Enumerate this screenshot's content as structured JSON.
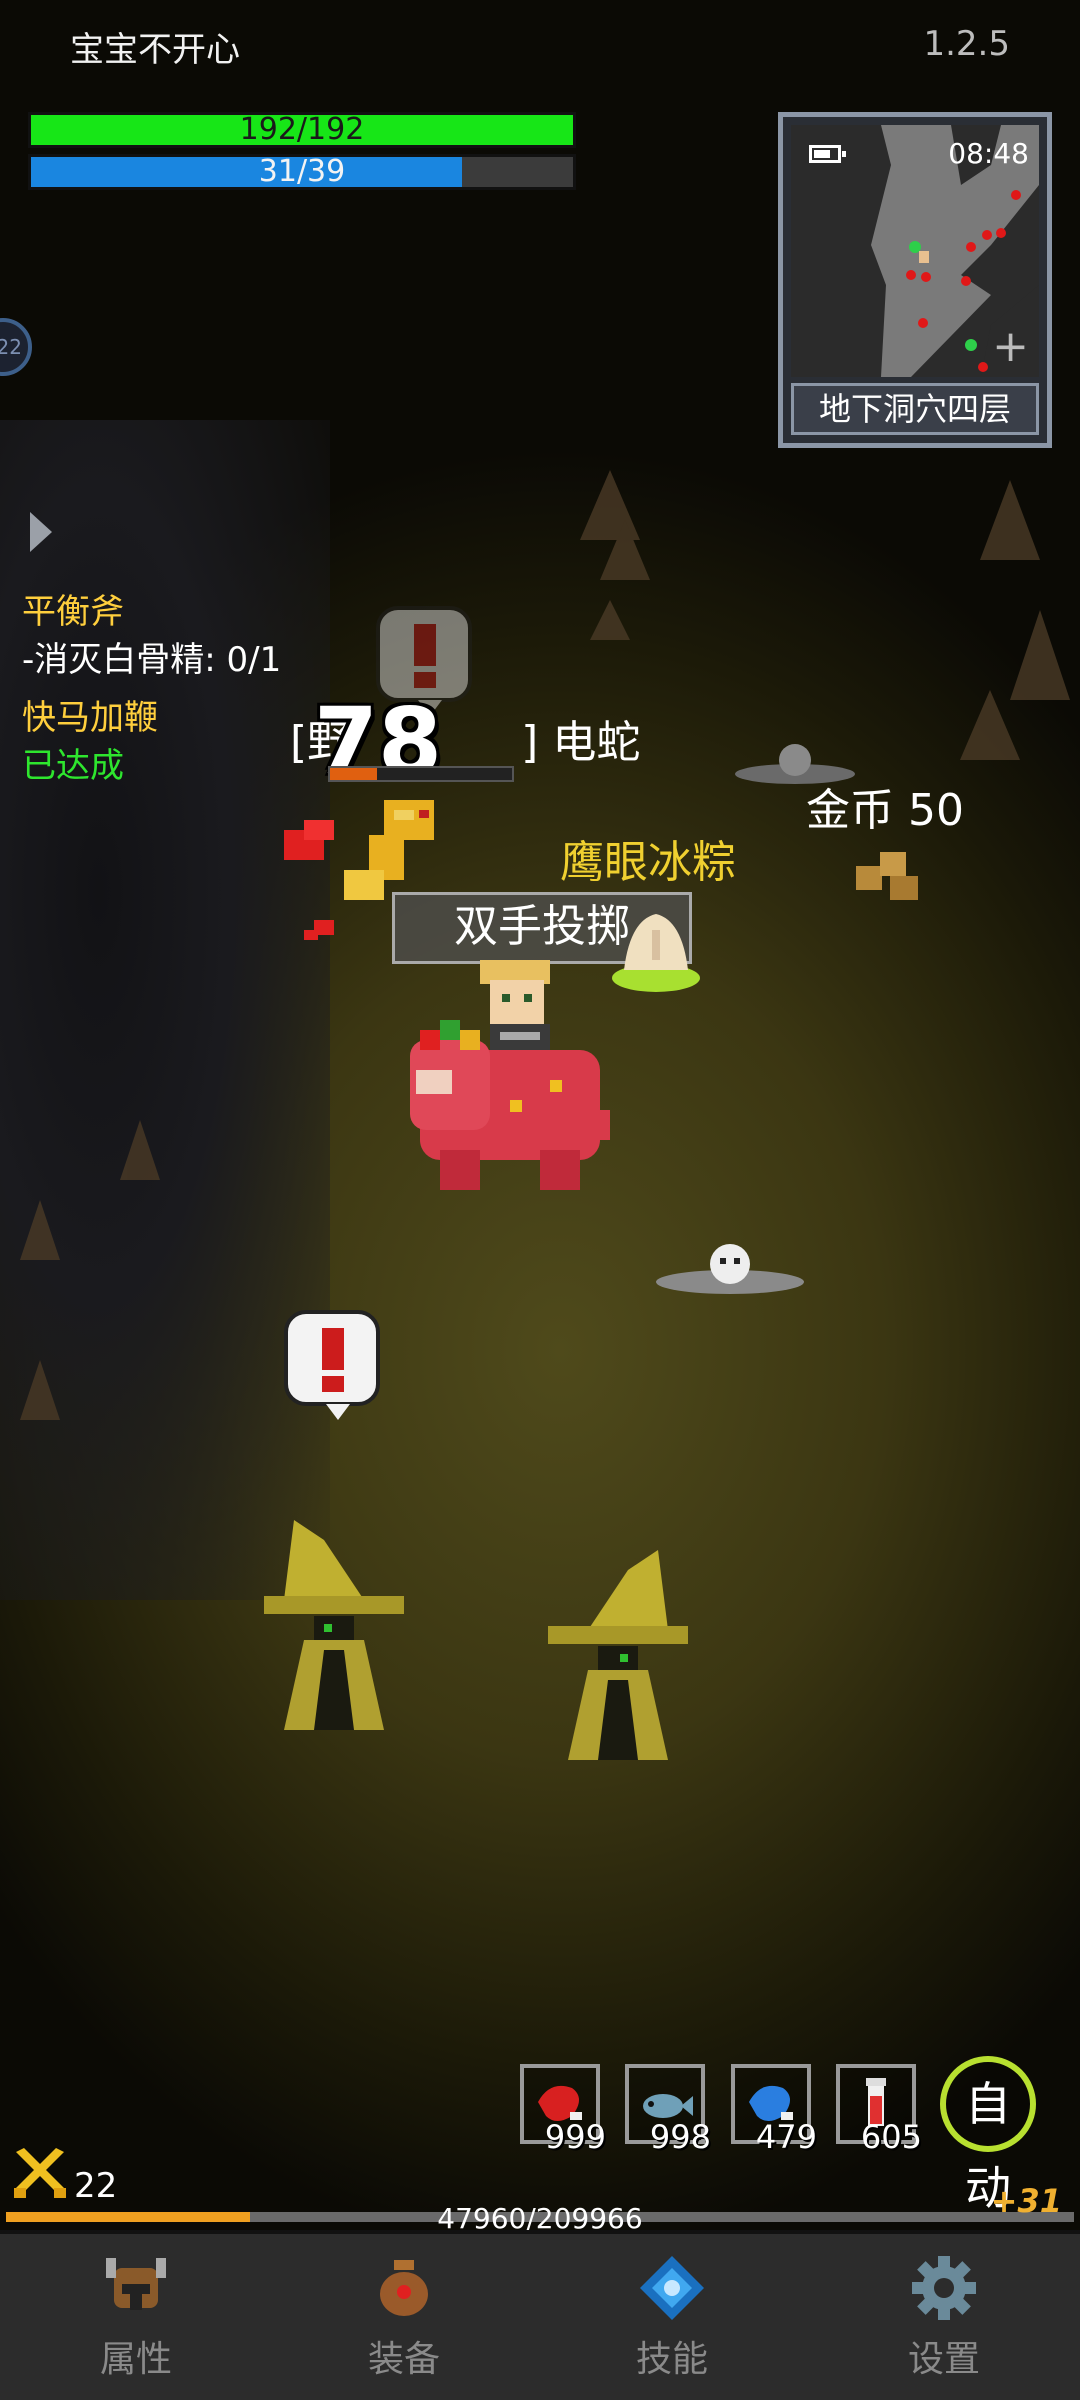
{
  "header": {
    "player_name": "宝宝不开心",
    "version": "1.2.5"
  },
  "stats": {
    "hp_text": "192/192",
    "hp_fraction": 1.0,
    "mp_text": "31/39",
    "mp_fraction": 0.795
  },
  "minimap": {
    "time": "08:48",
    "floor_label": "地下洞穴四层"
  },
  "side_badge": "22",
  "quests": [
    {
      "title": "平衡斧",
      "desc": "-消灭白骨精: 0/1"
    },
    {
      "title": "快马加鞭",
      "status": "已达成"
    }
  ],
  "scene": {
    "enemy_name_prefix": "[野",
    "enemy_name_suffix": "] 电蛇",
    "damage_number": "78",
    "enemy_hp_fraction": 0.26,
    "item_drop_name": "鹰眼冰粽",
    "skill_popup": "双手投掷",
    "coin_label": "金币 50"
  },
  "quick_items": [
    {
      "icon": "red-meat-icon",
      "count": "999",
      "color": "#d82020"
    },
    {
      "icon": "blue-fish-icon",
      "count": "998",
      "color": "#6fa0b8"
    },
    {
      "icon": "blue-meat-icon",
      "count": "479",
      "color": "#2a7ee0"
    },
    {
      "icon": "potion-icon",
      "count": "605",
      "color": "#e03030"
    }
  ],
  "auto_button": "自动",
  "level": {
    "value": "22",
    "exp_text": "47960/209966",
    "exp_fraction": 0.2284,
    "exp_gain": "+31"
  },
  "nav": {
    "attributes": "属性",
    "equipment": "装备",
    "skills": "技能",
    "settings": "设置"
  },
  "colors": {
    "hp": "#17e617",
    "mp": "#1a86e0",
    "quest_title": "#ffcf3d",
    "quest_done": "#2ee62e",
    "item_drop": "#f0d030",
    "exp": "#f0a020"
  }
}
